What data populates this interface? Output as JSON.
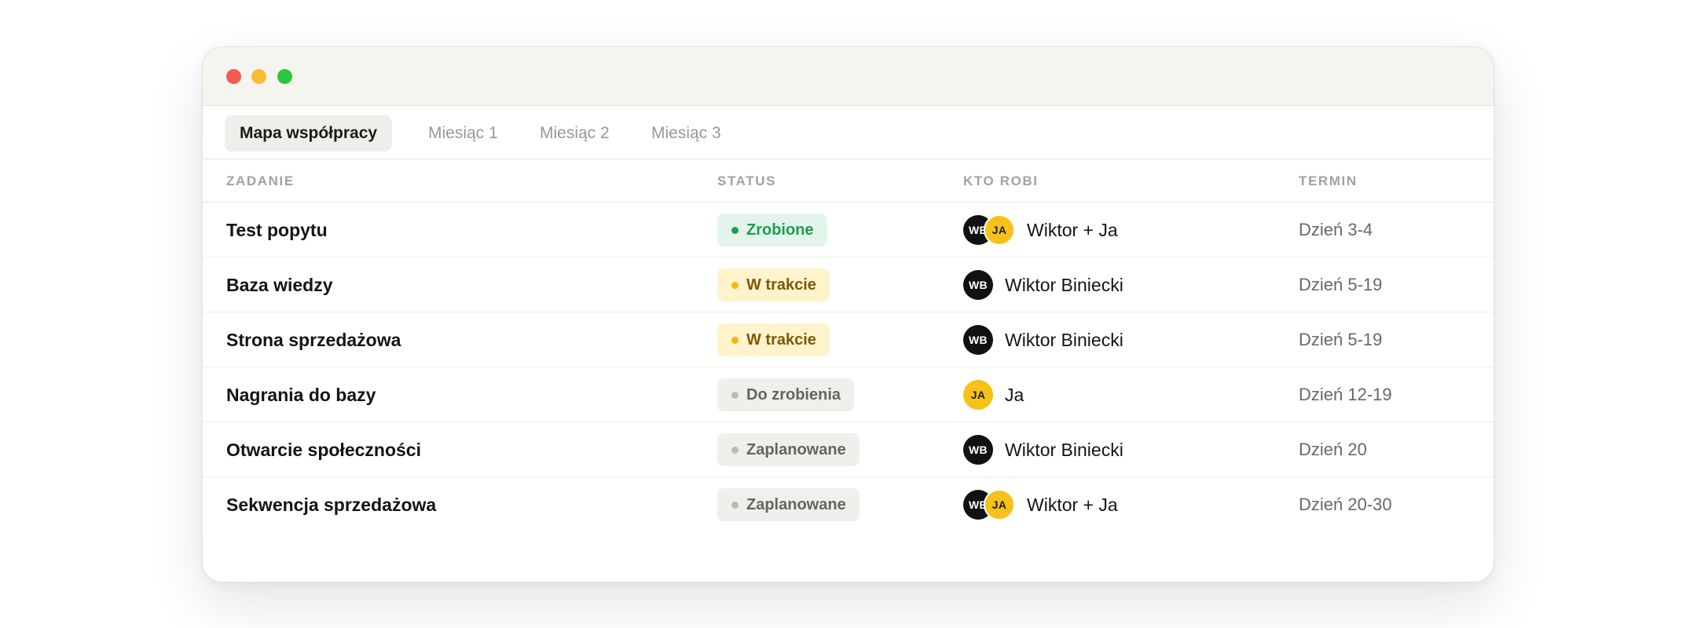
{
  "tabs": [
    {
      "label": "Mapa współpracy",
      "active": true
    },
    {
      "label": "Miesiąc 1",
      "active": false
    },
    {
      "label": "Miesiąc 2",
      "active": false
    },
    {
      "label": "Miesiąc 3",
      "active": false
    }
  ],
  "headers": {
    "task": "ZADANIE",
    "status": "STATUS",
    "who": "KTO ROBI",
    "term": "TERMIN"
  },
  "rows": [
    {
      "task": "Test popytu",
      "status": "Zrobione",
      "status_type": "done",
      "avatars": [
        "WB",
        "JA"
      ],
      "who": "Wiktor + Ja",
      "term": "Dzień 3-4"
    },
    {
      "task": "Baza wiedzy",
      "status": "W trakcie",
      "status_type": "progress",
      "avatars": [
        "WB"
      ],
      "who": "Wiktor Biniecki",
      "term": "Dzień 5-19"
    },
    {
      "task": "Strona sprzedażowa",
      "status": "W trakcie",
      "status_type": "progress",
      "avatars": [
        "WB"
      ],
      "who": "Wiktor Biniecki",
      "term": "Dzień 5-19"
    },
    {
      "task": "Nagrania do bazy",
      "status": "Do zrobienia",
      "status_type": "todo",
      "avatars": [
        "JA"
      ],
      "who": "Ja",
      "term": "Dzień 12-19"
    },
    {
      "task": "Otwarcie społeczności",
      "status": "Zaplanowane",
      "status_type": "todo",
      "avatars": [
        "WB"
      ],
      "who": "Wiktor Biniecki",
      "term": "Dzień 20"
    },
    {
      "task": "Sekwencja sprzedażowa",
      "status": "Zaplanowane",
      "status_type": "todo",
      "avatars": [
        "WB",
        "JA"
      ],
      "who": "Wiktor + Ja",
      "term": "Dzień 20-30"
    }
  ],
  "colors": {
    "close": "#f15b50",
    "minimize": "#f7bd2e",
    "maximize": "#27c840",
    "done": "#1f9b53",
    "progress": "#f1b711",
    "todo": "#bdbbb6",
    "avatar_wb": "#111111",
    "avatar_ja": "#f6c21a"
  }
}
